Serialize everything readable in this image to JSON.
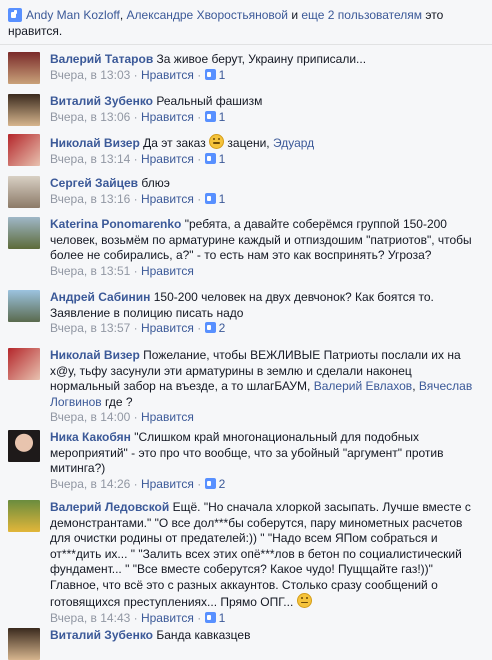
{
  "likes": {
    "text_pre_1": "Andy Man Kozloff",
    "text_sep": ", ",
    "text_pre_2": "Александре Хворостьяновой",
    "text_and": " и ",
    "text_others": "еще 2 пользователям",
    "text_post": " это нравится."
  },
  "action_like": "Нравится",
  "comments": [
    {
      "name": "Валерий Татаров",
      "text": "За живое берут, Украину приписали...",
      "time": "Вчера, в 13:03",
      "likes": "1"
    },
    {
      "name": "Виталий Зубенко",
      "text": "Реальный фашизм",
      "time": "Вчера, в 13:06",
      "likes": "1"
    },
    {
      "name": "Николай Визер",
      "text_before": "Да эт заказ",
      "text_after": "зацени,",
      "mention": "Эдуард",
      "time": "Вчера, в 13:14",
      "likes": "1"
    },
    {
      "name": "Сергей Зайцев",
      "text": "блюэ",
      "time": "Вчера, в 13:16",
      "likes": "1"
    },
    {
      "name": "Katerina Ponomarenko",
      "text": "\"ребята, а давайте соберёмся группой 150-200 человек, возьмём по арматурине каждый и отпиздошим \"патриотов\", чтобы более не собирались, а?\" - то есть нам это как воспринять? Угроза?",
      "time": "Вчера, в 13:51"
    },
    {
      "name": "Андрей Сабинин",
      "text": "150-200 человек на двух девчонок? Как боятся то. Заявление в полицию писать надо",
      "time": "Вчера, в 13:57",
      "likes": "2"
    },
    {
      "name": "Николай Визер",
      "text": "Пожелание, чтобы ВЕЖЛИВЫЕ Патриоты послали их на х@у, тьфу засунули эти арматурины в землю и сделали наконец нормальный забор на въезде, а то шлагБАУМ,",
      "mention1": "Валерий Евлахов",
      "sep": ", ",
      "mention2": "Вячеслав Логвинов",
      "tail": "где ?",
      "time": "Вчера, в 14:00"
    },
    {
      "name": "Ника Какобян",
      "text": "\"Слишком край многонациональный для подобных мероприятий\" - это про что вообще, что за убойный \"аргумент\" против митинга?)",
      "time": "Вчера, в 14:26",
      "likes": "2"
    },
    {
      "name": "Валерий Ледовской",
      "text": "Ещё. \"Но сначала хлоркой засыпать. Лучше вместе с демонстрантами.\" \"О все дол***бы соберутся, пару минометных расчетов для очистки родины от предателей:)) \" \"Надо всем ЯПом собраться и от***дить их... \" \"Залить всех этих опё***лов в бетон по социалистический фундамент... \" \"Все вместе соберутся? Какое чудо! Пущщайте газ!))\" Главное, что всё это с разных аккаунтов. Столько сразу сообщений о готовящихся преступлениях... Прямо ОПГ...",
      "time": "Вчера, в 14:43",
      "likes": "1"
    },
    {
      "name": "Виталий Зубенко",
      "text": "Банда кавказцев",
      "time": ""
    }
  ],
  "colors": {
    "link": "#3b5998",
    "meta": "#9197a3",
    "thumb": "#5890ff",
    "bg": "#f6f7f9"
  }
}
